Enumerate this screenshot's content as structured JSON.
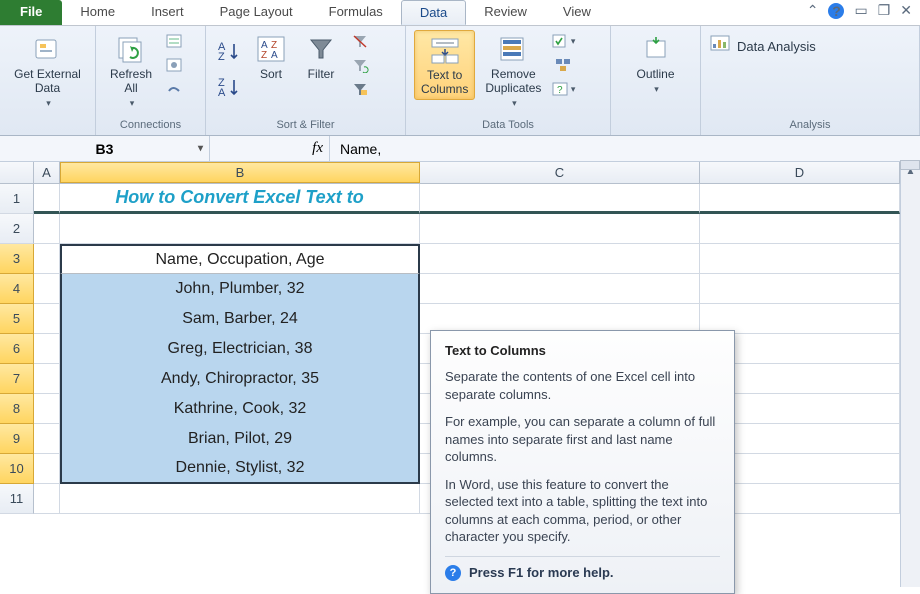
{
  "tabs": {
    "file": "File",
    "items": [
      "Home",
      "Insert",
      "Page Layout",
      "Formulas",
      "Data",
      "Review",
      "View"
    ],
    "active_index": 4
  },
  "ribbon": {
    "groups": {
      "getdata": {
        "btn": "Get External\nData",
        "label": ""
      },
      "connections": {
        "refresh": "Refresh\nAll",
        "label": "Connections"
      },
      "sortfilter": {
        "sort": "Sort",
        "filter": "Filter",
        "label": "Sort & Filter"
      },
      "datatools": {
        "ttc": "Text to\nColumns",
        "remove": "Remove\nDuplicates",
        "label": "Data Tools"
      },
      "outline": {
        "btn": "Outline",
        "label": ""
      },
      "analysis": {
        "btn": "Data Analysis",
        "label": "Analysis"
      }
    }
  },
  "formula_bar": {
    "name": "B3",
    "fx": "fx",
    "value": "Name,"
  },
  "columns": [
    "A",
    "B",
    "C",
    "D"
  ],
  "sheet": {
    "title": "How to Convert Excel Text to",
    "rows": [
      "Name, Occupation, Age",
      "John, Plumber, 32",
      "Sam, Barber, 24",
      "Greg, Electrician, 38",
      "Andy, Chiropractor, 35",
      "Kathrine, Cook, 32",
      "Brian, Pilot, 29",
      "Dennie, Stylist, 32"
    ]
  },
  "tooltip": {
    "title": "Text to Columns",
    "p1": "Separate the contents of one Excel cell into separate columns.",
    "p2": "For example, you can separate a column of full names into separate first and last name columns.",
    "p3": "In Word, use this feature to convert the selected text into a table, splitting the text into columns at each comma, period, or other character you specify.",
    "foot": "Press F1 for more help."
  }
}
